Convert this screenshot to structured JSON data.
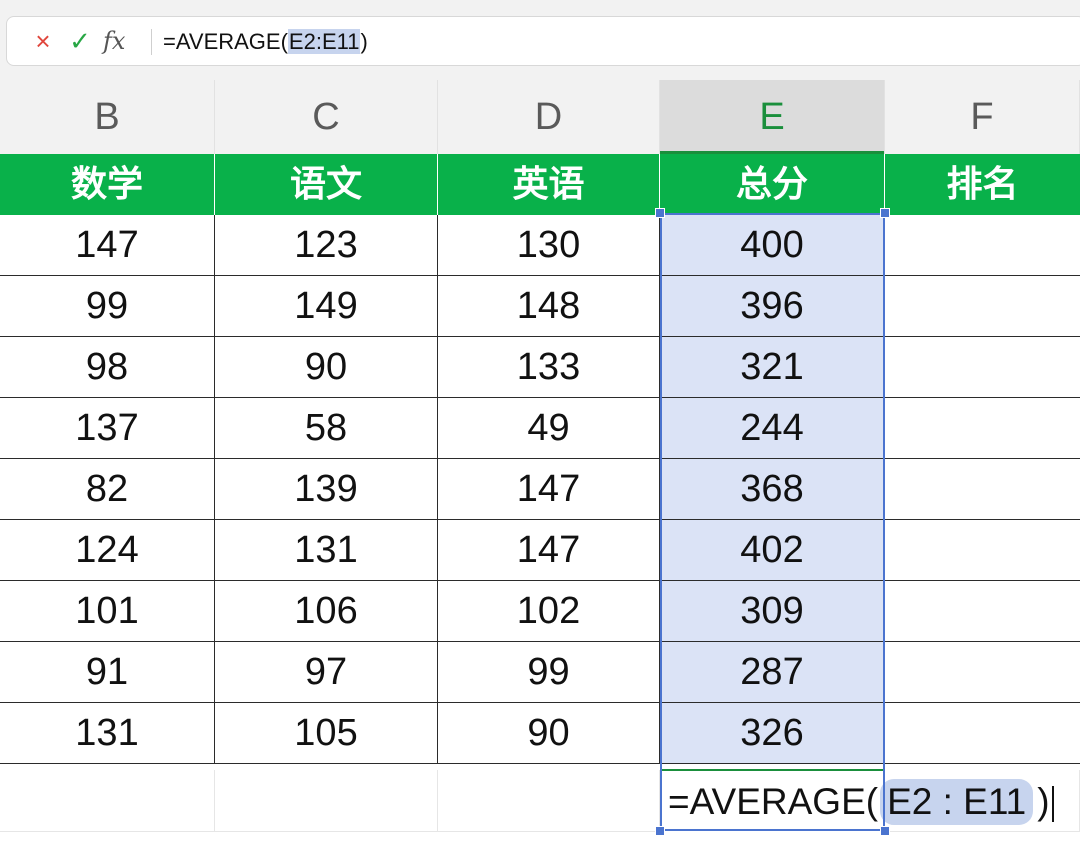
{
  "formula_bar": {
    "cancel_icon": "×",
    "confirm_icon": "✓",
    "fx_label": "fx",
    "formula_prefix": "=AVERAGE(",
    "formula_ref": "E2:E11",
    "formula_suffix": ")"
  },
  "columns": [
    "B",
    "C",
    "D",
    "E",
    "F"
  ],
  "active_column": "E",
  "headers": [
    "数学",
    "语文",
    "英语",
    "总分",
    "排名"
  ],
  "rows": [
    [
      "147",
      "123",
      "130",
      "400",
      ""
    ],
    [
      "99",
      "149",
      "148",
      "396",
      ""
    ],
    [
      "98",
      "90",
      "133",
      "321",
      ""
    ],
    [
      "137",
      "58",
      "49",
      "244",
      ""
    ],
    [
      "82",
      "139",
      "147",
      "368",
      ""
    ],
    [
      "124",
      "131",
      "147",
      "402",
      ""
    ],
    [
      "101",
      "106",
      "102",
      "309",
      ""
    ],
    [
      "91",
      "97",
      "99",
      "287",
      ""
    ],
    [
      "131",
      "105",
      "90",
      "326",
      ""
    ]
  ],
  "edit_cell": {
    "prefix": "=AVERAGE(",
    "ref": "E2 : E11",
    "suffix": ")"
  },
  "colors": {
    "header_green": "#09b14a",
    "selection_blue": "#4b74cf",
    "selection_fill": "#dbe3f6",
    "active_column_text": "#1a8f3c"
  }
}
